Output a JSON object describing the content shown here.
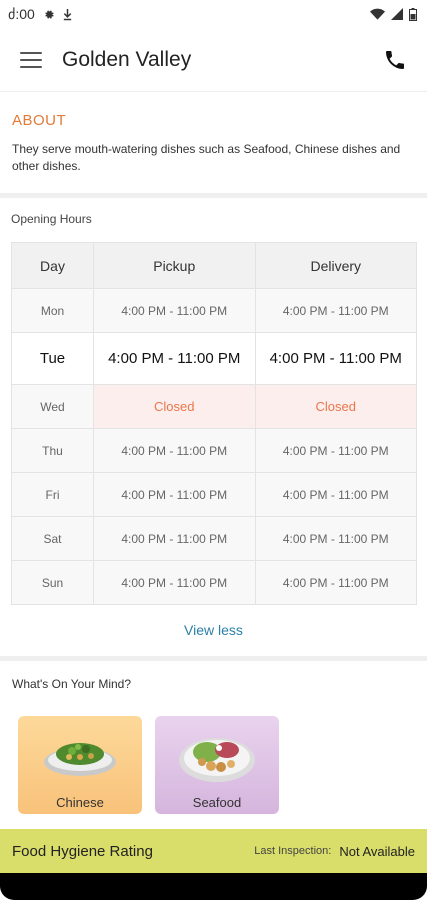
{
  "status_bar": {
    "time": "ძ:00"
  },
  "app_bar": {
    "title": "Golden Valley"
  },
  "about": {
    "title": "ABOUT",
    "text": "They serve mouth-watering dishes such as Seafood, Chinese dishes and other dishes."
  },
  "hours": {
    "title": "Opening Hours",
    "headers": [
      "Day",
      "Pickup",
      "Delivery"
    ],
    "rows": [
      {
        "day": "Mon",
        "pickup": "4:00 PM - 11:00 PM",
        "delivery": "4:00 PM - 11:00 PM"
      },
      {
        "day": "Tue",
        "pickup": "4:00 PM - 11:00 PM",
        "delivery": "4:00 PM - 11:00 PM"
      },
      {
        "day": "Wed",
        "pickup": "Closed",
        "delivery": "Closed"
      },
      {
        "day": "Thu",
        "pickup": "4:00 PM - 11:00 PM",
        "delivery": "4:00 PM - 11:00 PM"
      },
      {
        "day": "Fri",
        "pickup": "4:00 PM - 11:00 PM",
        "delivery": "4:00 PM - 11:00 PM"
      },
      {
        "day": "Sat",
        "pickup": "4:00 PM - 11:00 PM",
        "delivery": "4:00 PM - 11:00 PM"
      },
      {
        "day": "Sun",
        "pickup": "4:00 PM - 11:00 PM",
        "delivery": "4:00 PM - 11:00 PM"
      }
    ],
    "toggle_label": "View less"
  },
  "mind": {
    "title": "What's On Your Mind?",
    "categories": [
      {
        "label": "Chinese"
      },
      {
        "label": "Seafood"
      }
    ]
  },
  "hygiene": {
    "title": "Food Hygiene Rating",
    "inspection_label": "Last Inspection:",
    "inspection_value": "Not Available"
  },
  "colors": {
    "accent": "#e07b39",
    "link": "#2b7fa8",
    "hygiene_bar": "#d9dd6a",
    "closed_bg": "#fdeeee"
  }
}
